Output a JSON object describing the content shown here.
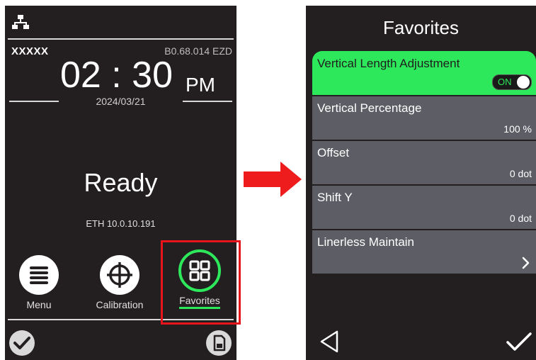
{
  "left_screen": {
    "model": "XXXXX",
    "firmware": "B0.68.014  EZD",
    "time": "02 : 30",
    "ampm": "PM",
    "date": "2024/03/21",
    "status": "Ready",
    "network": "ETH 10.0.10.191",
    "buttons": {
      "menu": "Menu",
      "calibration": "Calibration",
      "favorites": "Favorites"
    }
  },
  "right_screen": {
    "title": "Favorites",
    "items": [
      {
        "label": "Vertical Length Adjustment",
        "toggle": "ON"
      },
      {
        "label": "Vertical Percentage",
        "value": "100 %"
      },
      {
        "label": "Offset",
        "value": "0 dot"
      },
      {
        "label": "Shift Y",
        "value": "0 dot"
      },
      {
        "label": "Linerless Maintain"
      }
    ]
  },
  "colors": {
    "screen_bg": "#231f20",
    "accent_green": "#2ee85b",
    "item_bg": "#5d5d66",
    "highlight_red": "#e8141b"
  },
  "icons": [
    "network-icon",
    "menu-icon",
    "calibration-icon",
    "favorites-icon",
    "check-icon",
    "memory-card-icon",
    "back-triangle-icon",
    "chevron-right-icon",
    "arrow-right-icon"
  ]
}
